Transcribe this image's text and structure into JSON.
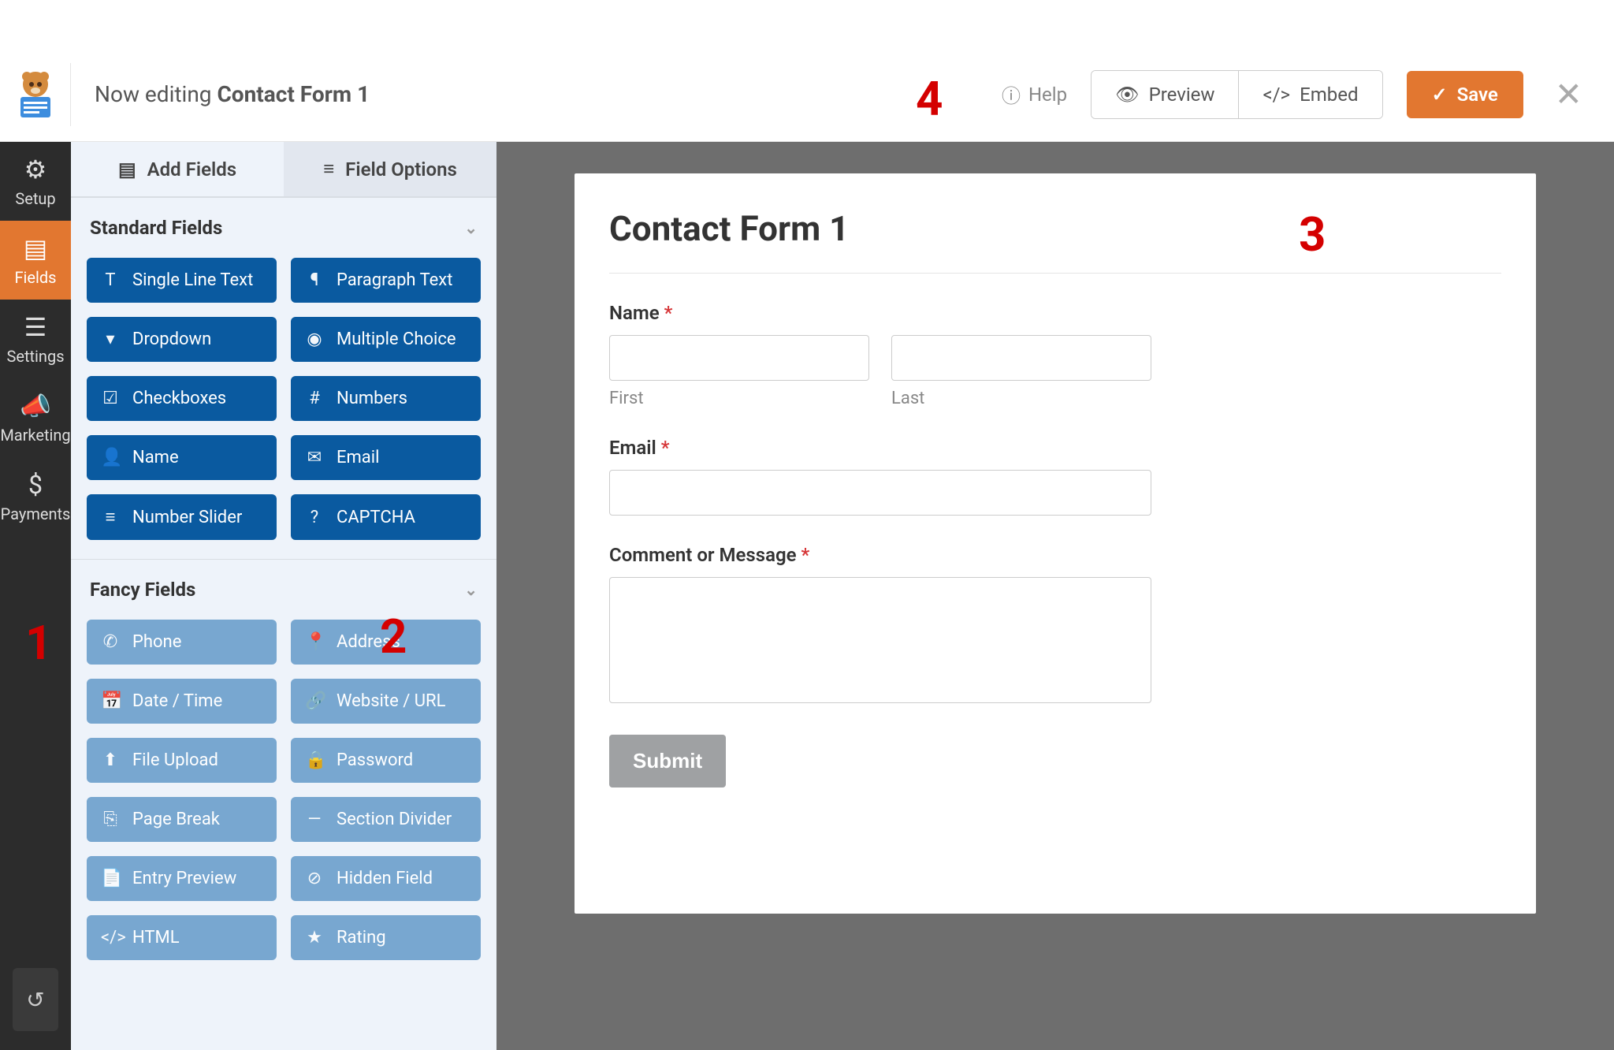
{
  "topbar": {
    "now_editing_label": "Now editing ",
    "form_name": "Contact Form 1",
    "help_label": "Help",
    "preview_label": "Preview",
    "embed_label": "Embed",
    "save_label": "Save"
  },
  "leftnav": {
    "items": [
      {
        "label": "Setup"
      },
      {
        "label": "Fields"
      },
      {
        "label": "Settings"
      },
      {
        "label": "Marketing"
      },
      {
        "label": "Payments"
      }
    ]
  },
  "panel_tabs": {
    "add_fields": "Add Fields",
    "field_options": "Field Options"
  },
  "standard_fields": {
    "heading": "Standard Fields",
    "items": [
      {
        "icon": "T",
        "label": "Single Line Text"
      },
      {
        "icon": "¶",
        "label": "Paragraph Text"
      },
      {
        "icon": "▾",
        "label": "Dropdown"
      },
      {
        "icon": "◉",
        "label": "Multiple Choice"
      },
      {
        "icon": "☑",
        "label": "Checkboxes"
      },
      {
        "icon": "#",
        "label": "Numbers"
      },
      {
        "icon": "👤",
        "label": "Name"
      },
      {
        "icon": "✉",
        "label": "Email"
      },
      {
        "icon": "≡",
        "label": "Number Slider"
      },
      {
        "icon": "?",
        "label": "CAPTCHA"
      }
    ]
  },
  "fancy_fields": {
    "heading": "Fancy Fields",
    "items": [
      {
        "icon": "✆",
        "label": "Phone"
      },
      {
        "icon": "📍",
        "label": "Address"
      },
      {
        "icon": "📅",
        "label": "Date / Time"
      },
      {
        "icon": "🔗",
        "label": "Website / URL"
      },
      {
        "icon": "⬆",
        "label": "File Upload"
      },
      {
        "icon": "🔒",
        "label": "Password"
      },
      {
        "icon": "⎘",
        "label": "Page Break"
      },
      {
        "icon": "—",
        "label": "Section Divider"
      },
      {
        "icon": "📄",
        "label": "Entry Preview"
      },
      {
        "icon": "⊘",
        "label": "Hidden Field"
      },
      {
        "icon": "</>",
        "label": "HTML"
      },
      {
        "icon": "★",
        "label": "Rating"
      }
    ]
  },
  "form_preview": {
    "title": "Contact Form 1",
    "name_label": "Name",
    "first_sub": "First",
    "last_sub": "Last",
    "email_label": "Email",
    "comment_label": "Comment or Message",
    "submit_label": "Submit",
    "required_mark": "*"
  },
  "annotations": {
    "n1": "1",
    "n2": "2",
    "n3": "3",
    "n4": "4"
  }
}
